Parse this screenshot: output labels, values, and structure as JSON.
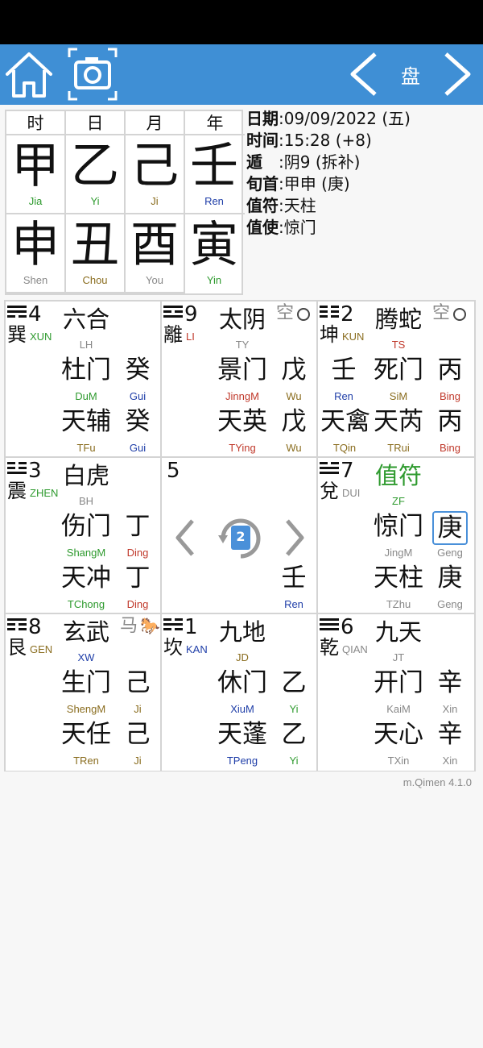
{
  "toolbar": {
    "title": "盘",
    "home_icon": "home-icon",
    "camera_icon": "camera-icon",
    "prev_icon": "chevron-left-icon",
    "next_icon": "chevron-right-icon",
    "bg_color": "#3f8fd5"
  },
  "pillars": {
    "headers": [
      "时",
      "日",
      "月",
      "年"
    ],
    "stems": [
      {
        "char": "甲",
        "py": "Jia",
        "color": "#2e9a2e"
      },
      {
        "char": "乙",
        "py": "Yi",
        "color": "#2e9a2e"
      },
      {
        "char": "己",
        "py": "Ji",
        "color": "#8a6d1f"
      },
      {
        "char": "壬",
        "py": "Ren",
        "color": "#1f3ea8"
      }
    ],
    "branches": [
      {
        "char": "申",
        "py": "Shen",
        "color": "#888888"
      },
      {
        "char": "丑",
        "py": "Chou",
        "color": "#8a6d1f"
      },
      {
        "char": "酉",
        "py": "You",
        "color": "#888888"
      },
      {
        "char": "寅",
        "py": "Yin",
        "color": "#2e9a2e"
      }
    ]
  },
  "info": {
    "date_label": "日期",
    "date_value": ":09/09/2022 (五)",
    "time_label": "时间",
    "time_value": ":15:28 (+8)",
    "dun_label": "遁",
    "dun_value": ":阴9 (拆补)",
    "xunshou_label": "旬首",
    "xunshou_value": ":甲申 (庚)",
    "zhifu_label": "值符",
    "zhifu_value": ":天柱",
    "zhishi_label": "值使",
    "zhishi_value": ":惊门"
  },
  "palaces": {
    "p4": {
      "num": "4",
      "gua": "巽",
      "gua_py": "XUN",
      "spirit": "六合",
      "spirit_py": "LH",
      "door": "杜门",
      "door_py": "DuM",
      "star": "天辅",
      "star_py": "TFu",
      "s1": "癸",
      "s1_py": "Gui",
      "s2": "癸",
      "s2_py": "Gui"
    },
    "p9": {
      "num": "9",
      "gua": "離",
      "gua_py": "LI",
      "spirit": "太阴",
      "spirit_py": "TY",
      "marker": "空",
      "door": "景门",
      "door_py": "JinngM",
      "star": "天英",
      "star_py": "TYing",
      "s1": "戊",
      "s1_py": "Wu",
      "s2": "戊",
      "s2_py": "Wu"
    },
    "p2": {
      "num": "2",
      "gua": "坤",
      "gua_py": "KUN",
      "spirit": "腾蛇",
      "spirit_py": "TS",
      "marker": "空",
      "door": "死门",
      "door_py": "SiM",
      "star": "天芮",
      "star_py": "TRui",
      "s1": "丙",
      "s1_py": "Bing",
      "s2": "丙",
      "s2_py": "Bing",
      "s0": "壬",
      "s0_py": "Ren",
      "s3": "天禽",
      "s3_py": "TQin"
    },
    "p3": {
      "num": "3",
      "gua": "震",
      "gua_py": "ZHEN",
      "spirit": "白虎",
      "spirit_py": "BH",
      "door": "伤门",
      "door_py": "ShangM",
      "star": "天冲",
      "star_py": "TChong",
      "s1": "丁",
      "s1_py": "Ding",
      "s2": "丁",
      "s2_py": "Ding"
    },
    "p5": {
      "num": "5",
      "stem": "壬",
      "stem_py": "Ren",
      "badge": "2"
    },
    "p7": {
      "num": "7",
      "gua": "兌",
      "gua_py": "DUI",
      "spirit": "值符",
      "spirit_py": "ZF",
      "door": "惊门",
      "door_py": "JingM",
      "star": "天柱",
      "star_py": "TZhu",
      "s1": "庚",
      "s1_py": "Geng",
      "s2": "庚",
      "s2_py": "Geng"
    },
    "p8": {
      "num": "8",
      "gua": "艮",
      "gua_py": "GEN",
      "spirit": "玄武",
      "spirit_py": "XW",
      "marker": "马",
      "door": "生门",
      "door_py": "ShengM",
      "star": "天任",
      "star_py": "TRen",
      "s1": "己",
      "s1_py": "Ji",
      "s2": "己",
      "s2_py": "Ji"
    },
    "p1": {
      "num": "1",
      "gua": "坎",
      "gua_py": "KAN",
      "spirit": "九地",
      "spirit_py": "JD",
      "door": "休门",
      "door_py": "XiuM",
      "star": "天蓬",
      "star_py": "TPeng",
      "s1": "乙",
      "s1_py": "Yi",
      "s2": "乙",
      "s2_py": "Yi"
    },
    "p6": {
      "num": "6",
      "gua": "乾",
      "gua_py": "QIAN",
      "spirit": "九天",
      "spirit_py": "JT",
      "door": "开门",
      "door_py": "KaiM",
      "star": "天心",
      "star_py": "TXin",
      "s1": "辛",
      "s1_py": "Xin",
      "s2": "辛",
      "s2_py": "Xin"
    }
  },
  "brand": "m.Qimen 4.1.0"
}
